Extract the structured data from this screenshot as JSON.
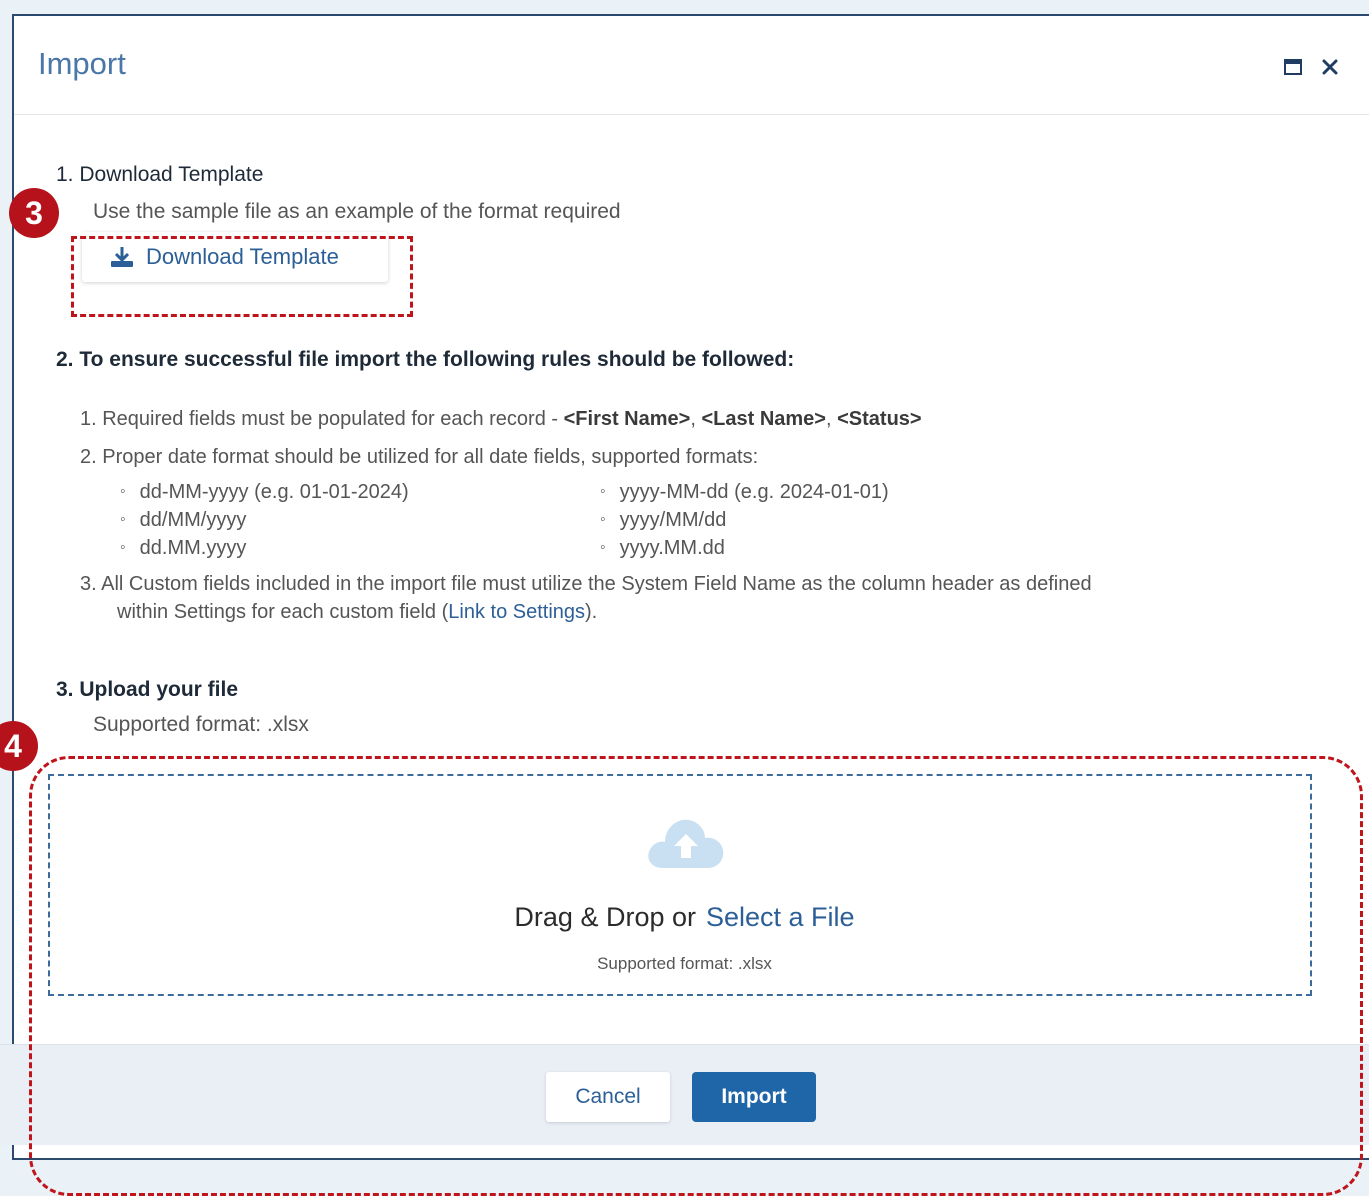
{
  "dialog": {
    "title": "Import",
    "maximize_icon": "window-maximize-icon",
    "close_icon": "close-icon"
  },
  "step1": {
    "title": "1. Download Template",
    "description": "Use the sample file as an example of the format required",
    "button_label": "Download Template",
    "button_icon": "download-icon"
  },
  "step2": {
    "title": "2. To ensure successful file import the following rules should be followed:",
    "rule1_prefix": "1. Required fields must be populated for each record - ",
    "rule1_fields": [
      "<First Name>",
      "<Last Name>",
      "<Status>"
    ],
    "rule1_sep": ", ",
    "rule2": "2. Proper date format should be utilized for all date fields, supported formats:",
    "formats_left": [
      "dd-MM-yyyy (e.g. 01-01-2024)",
      "dd/MM/yyyy",
      "dd.MM.yyyy"
    ],
    "formats_right": [
      "yyyy-MM-dd (e.g. 2024-01-01)",
      "yyyy/MM/dd",
      "yyyy.MM.dd"
    ],
    "rule3_line1": "3. All Custom fields included in the import file must utilize the System Field Name as the column header as defined",
    "rule3_line2_prefix": "within Settings for each custom field (",
    "rule3_link": "Link to Settings",
    "rule3_line2_suffix": ")."
  },
  "step3": {
    "title": "3. Upload your file",
    "description": "Supported format: .xlsx"
  },
  "dropzone": {
    "icon": "cloud-upload-icon",
    "text": "Drag & Drop or",
    "select_link": "Select a File",
    "supported": "Supported format: .xlsx"
  },
  "footer": {
    "cancel_label": "Cancel",
    "import_label": "Import"
  },
  "annotations": [
    {
      "label": "3"
    },
    {
      "label": "4"
    }
  ],
  "colors": {
    "accent": "#2c5f97",
    "primary_button": "#1f66a8",
    "annotation": "#c0141b"
  }
}
